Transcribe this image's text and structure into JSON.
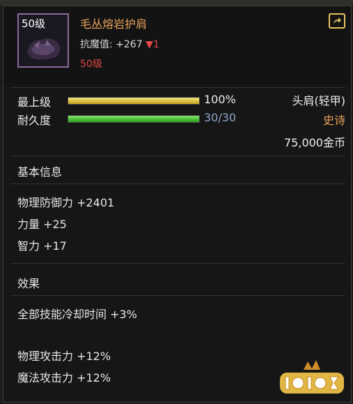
{
  "item": {
    "level_badge": "50级",
    "name": "毛丛熔岩护肩",
    "stat_line": "抗魔值: +267",
    "stat_delta": "▼1",
    "required_level": "50级"
  },
  "bars": [
    {
      "label": "最上级",
      "value_text": "100%",
      "fill": 1.0
    },
    {
      "label": "耐久度",
      "value_text": "30/30",
      "fill": 1.0
    }
  ],
  "meta": {
    "slot_type": "头肩(轻甲)",
    "rarity": "史诗",
    "price": "75,000金币"
  },
  "basic_info": {
    "title": "基本信息",
    "lines": [
      "物理防御力 +2401",
      "力量 +25",
      "智力 +17"
    ]
  },
  "effects": {
    "title": "效果",
    "lines": [
      "全部技能冷却时间 +3%",
      "物理攻击力 +12%",
      "魔法攻击力 +12%"
    ]
  },
  "colors": {
    "item_name": "#e8a25b",
    "rarity": "#e8a25b",
    "warning": "#e44848",
    "durability_text": "#8fa6c8"
  },
  "icons": [
    "export-icon"
  ]
}
